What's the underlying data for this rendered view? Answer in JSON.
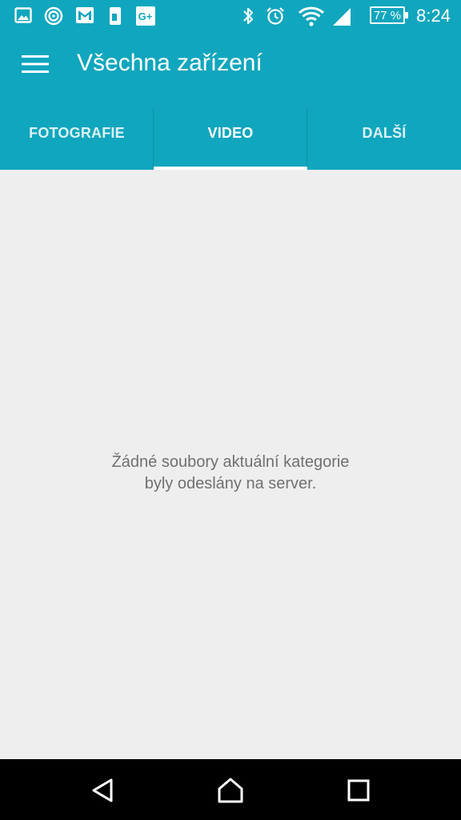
{
  "status_bar": {
    "time": "8:24",
    "battery_percent": "77 %",
    "left_icons": [
      "gallery-notification-icon",
      "radio-notification-icon",
      "gmail-notification-icon",
      "phone-notification-icon",
      "google-plus-notification-icon"
    ],
    "right_icons": [
      "bluetooth-icon",
      "alarm-icon",
      "wifi-icon",
      "cell-signal-icon",
      "battery-icon"
    ]
  },
  "app_bar": {
    "title": "Všechna zařízení",
    "menu_icon": "hamburger-menu-icon",
    "color": "#10a6be"
  },
  "tabs": [
    {
      "label": "FOTOGRAFIE",
      "selected": false
    },
    {
      "label": "VIDEO",
      "selected": true
    },
    {
      "label": "DALŠÍ",
      "selected": false
    }
  ],
  "content": {
    "empty_message_line1": "Žádné soubory aktuální kategorie",
    "empty_message_line2": "byly odeslány na server."
  },
  "nav_bar": {
    "icons": [
      "back-icon",
      "home-icon",
      "recents-icon"
    ]
  }
}
